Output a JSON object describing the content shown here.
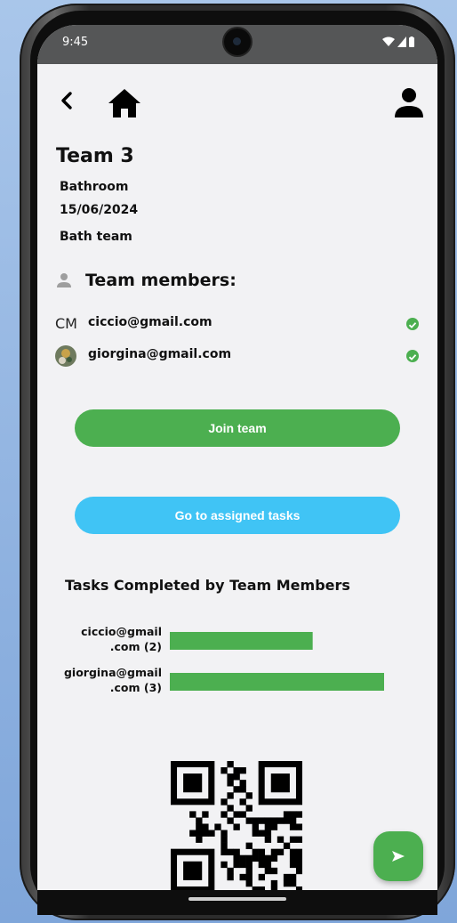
{
  "status_bar": {
    "time": "9:45"
  },
  "header": {
    "back_icon": "chevron-left-icon",
    "home_icon": "home-icon",
    "profile_icon": "person-icon"
  },
  "team": {
    "name": "Team 3",
    "room": "Bathroom",
    "date": "15/06/2024",
    "description": "Bath team"
  },
  "members_section": {
    "title": "Team members:",
    "icon": "person-icon",
    "members": [
      {
        "avatar_text": "CM",
        "email": "ciccio@gmail.com",
        "verified": true
      },
      {
        "avatar_text": "",
        "email": "giorgina@gmail.com",
        "verified": true
      }
    ]
  },
  "actions": {
    "join_label": "Join team",
    "tasks_label": "Go to assigned tasks"
  },
  "chart_data": {
    "type": "bar",
    "orientation": "horizontal",
    "title": "Tasks Completed by Team Members",
    "categories": [
      "ciccio@gmail.com (2)",
      "giorgina@gmail.com (3)"
    ],
    "category_lines": [
      [
        "ciccio@gmail",
        ".com (2)"
      ],
      [
        "giorgina@gmail",
        ".com (3)"
      ]
    ],
    "values": [
      2,
      3
    ],
    "xlim": [
      0,
      3
    ],
    "color": "#4caf50"
  },
  "colors": {
    "accent_green": "#4caf50",
    "accent_blue": "#40c4f5",
    "background": "#f2f2f4"
  },
  "fab": {
    "icon": "send-icon"
  },
  "qr": {
    "icon": "qr-code-icon"
  }
}
